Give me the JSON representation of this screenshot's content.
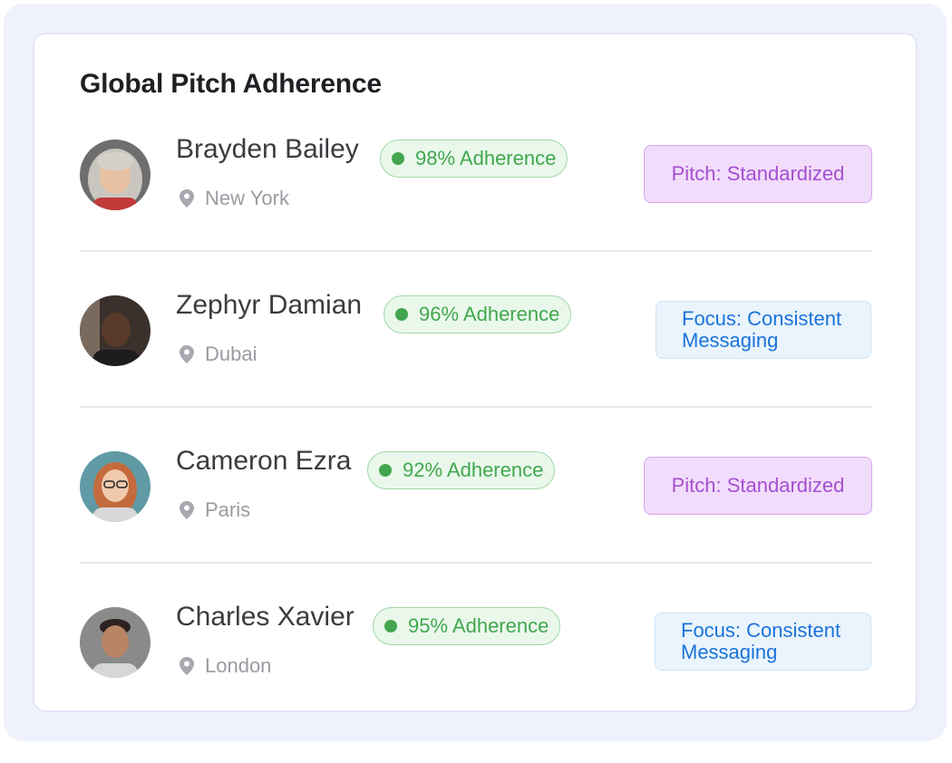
{
  "card": {
    "title": "Global Pitch Adherence"
  },
  "people": [
    {
      "name": "Brayden Bailey",
      "adherence": "98% Adherence",
      "location": "New York",
      "tag": "Pitch: Standardized",
      "tag_type": "pitch"
    },
    {
      "name": "Zephyr Damian",
      "adherence": "96% Adherence",
      "location": "Dubai",
      "tag": "Focus: Consistent Messaging",
      "tag_type": "focus"
    },
    {
      "name": "Cameron Ezra",
      "adherence": "92% Adherence",
      "location": "Paris",
      "tag": "Pitch: Standardized",
      "tag_type": "pitch"
    },
    {
      "name": "Charles Xavier",
      "adherence": "95% Adherence",
      "location": "London",
      "tag": "Focus: Consistent Messaging",
      "tag_type": "focus"
    }
  ],
  "colors": {
    "badge_green": "#43a54f",
    "pitch_purple": "#a44fd2",
    "focus_blue": "#1a73d9"
  },
  "icons": {
    "location": "map-pin-icon",
    "status": "status-dot-icon"
  }
}
